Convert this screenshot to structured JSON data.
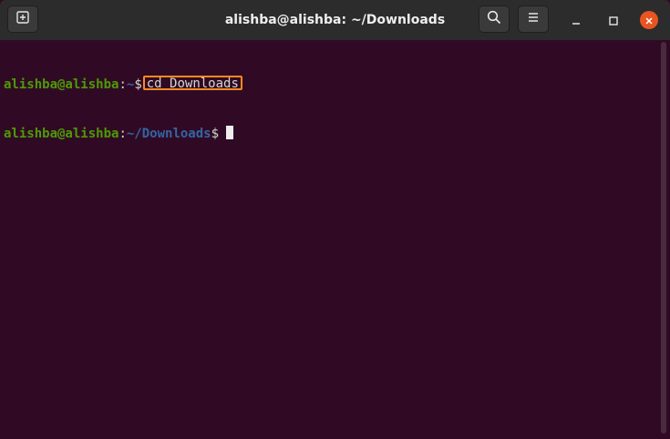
{
  "window": {
    "title": "alishba@alishba: ~/Downloads"
  },
  "titlebar": {
    "icons": {
      "new_tab": "new-tab-icon",
      "search": "search-icon",
      "menu": "hamburger-menu-icon",
      "minimize": "minimize-icon",
      "maximize": "maximize-icon",
      "close": "close-icon"
    }
  },
  "terminal": {
    "lines": [
      {
        "user_host": "alishba@alishba",
        "colon": ":",
        "path": "~",
        "dollar": "$",
        "command": "cd Downloads"
      },
      {
        "user_host": "alishba@alishba",
        "colon": ":",
        "path": "~/Downloads",
        "dollar": "$"
      }
    ]
  },
  "colors": {
    "background": "#300a24",
    "titlebar": "#2c2c2c",
    "prompt_user": "#4e9a06",
    "prompt_path": "#3465a4",
    "highlight_box": "#ff8a1e",
    "close_button": "#e95420"
  }
}
